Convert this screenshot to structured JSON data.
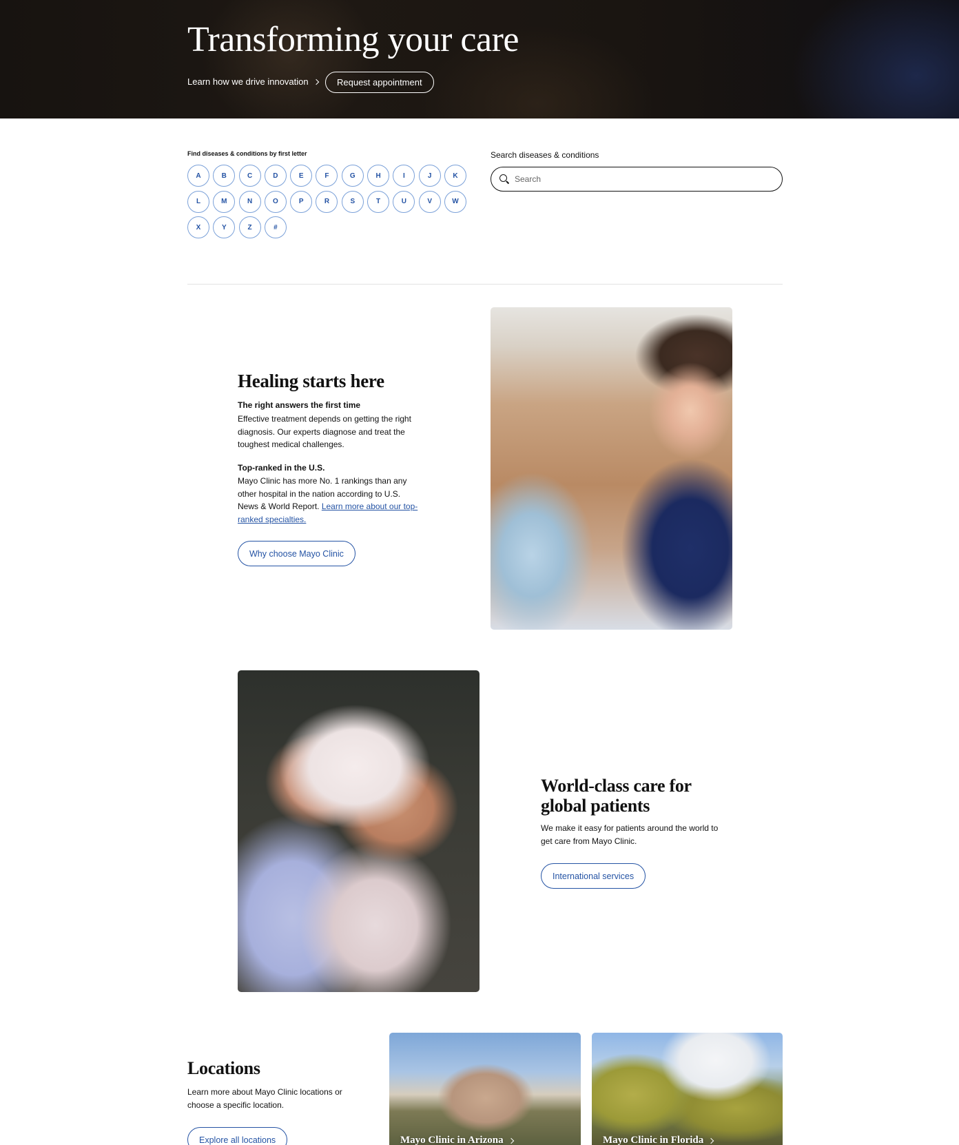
{
  "hero": {
    "title": "Transforming your care",
    "link_label": "Learn how we drive innovation",
    "button_label": "Request appointment"
  },
  "az": {
    "title": "Find diseases & conditions by first letter",
    "letters": [
      "A",
      "B",
      "C",
      "D",
      "E",
      "F",
      "G",
      "H",
      "I",
      "J",
      "K",
      "L",
      "M",
      "N",
      "O",
      "P",
      "R",
      "S",
      "T",
      "U",
      "V",
      "W",
      "X",
      "Y",
      "Z",
      "#"
    ]
  },
  "search": {
    "label": "Search diseases & conditions",
    "placeholder": "Search",
    "icon": "search-icon"
  },
  "healing": {
    "title": "Healing starts here",
    "subhead1": "The right answers the first time",
    "para1": "Effective treatment depends on getting the right diagnosis. Our experts diagnose and treat the toughest medical challenges.",
    "subhead2": "Top-ranked in the U.S.",
    "para2": "Mayo Clinic has more No. 1 rankings than any other hospital in the nation according to U.S. News & World Report.",
    "para2_link": "Learn more about our top-ranked specialties.",
    "button_label": "Why choose Mayo Clinic"
  },
  "world": {
    "title": "World-class care for global patients",
    "para": "We make it easy for patients around the world to get care from Mayo Clinic.",
    "button_label": "International services"
  },
  "locations": {
    "title": "Locations",
    "para": "Learn more about Mayo Clinic locations or choose a specific location.",
    "button_label": "Explore all locations",
    "cards": [
      {
        "label": "Mayo Clinic in Arizona"
      },
      {
        "label": "Mayo Clinic in Florida"
      }
    ]
  },
  "colors": {
    "link_blue": "#2453a4",
    "letter_border": "#7aa0d8",
    "text": "#111111"
  }
}
